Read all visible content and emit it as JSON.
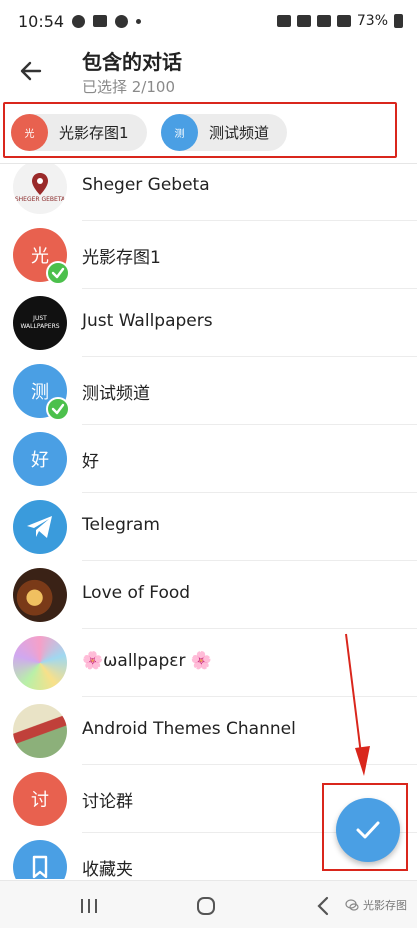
{
  "status_bar": {
    "time": "10:54",
    "battery": "73%"
  },
  "header": {
    "title": "包含的对话",
    "subtitle": "已选择 2/100"
  },
  "selected_chips": [
    {
      "avatar_text": "光",
      "label": "光影存图1",
      "color": "#e8614f"
    },
    {
      "avatar_text": "测",
      "label": "测试频道",
      "color": "#4a9fe4"
    }
  ],
  "chats": [
    {
      "name": "Sheger Gebeta",
      "avatar_text": "SHEGER GEBETA",
      "color": "#f2f2f2",
      "checked": false
    },
    {
      "name": "光影存图1",
      "avatar_text": "光",
      "color": "#e8614f",
      "checked": true
    },
    {
      "name": "Just Wallpapers",
      "avatar_text": "JUST WALLPAPERS",
      "color": "#111111",
      "checked": false
    },
    {
      "name": "测试频道",
      "avatar_text": "测",
      "color": "#4a9fe4",
      "checked": true
    },
    {
      "name": "好",
      "avatar_text": "好",
      "color": "#4a9fe4",
      "checked": false
    },
    {
      "name": "Telegram",
      "avatar_text": "",
      "color": "#3a9bdc",
      "checked": false
    },
    {
      "name": "Love of Food",
      "avatar_text": "",
      "color": "#6b3d22",
      "checked": false
    },
    {
      "name": "🌸ωallpapεr 🌸",
      "avatar_text": "",
      "color": "#e6c6e8",
      "checked": false
    },
    {
      "name": "Android Themes Channel",
      "avatar_text": "",
      "color": "#c7d9b8",
      "checked": false
    },
    {
      "name": "讨论群",
      "avatar_text": "讨",
      "color": "#e8614f",
      "checked": false
    },
    {
      "name": "收藏夹",
      "avatar_text": "",
      "color": "#4a9fe4",
      "checked": false
    }
  ],
  "watermark": "光影存图",
  "colors": {
    "accent": "#4a9fe4",
    "check": "#4cc04c",
    "highlight": "#d9261c"
  }
}
